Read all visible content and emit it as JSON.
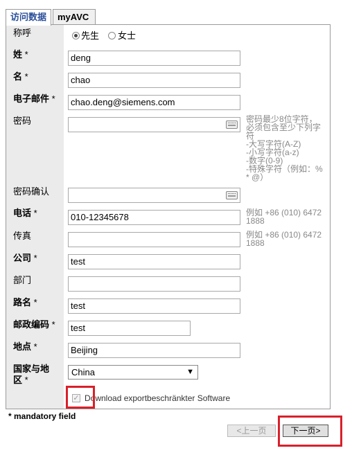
{
  "tabs": [
    {
      "label": "访问数据",
      "active": true
    },
    {
      "label": "myAVC",
      "active": false
    }
  ],
  "form": {
    "salutation": {
      "label": "称呼",
      "options": [
        {
          "label": "先生",
          "selected": true
        },
        {
          "label": "女士",
          "selected": false
        }
      ]
    },
    "last_name": {
      "label": "姓",
      "required_mark": "*",
      "value": "deng"
    },
    "first_name": {
      "label": "名",
      "required_mark": "*",
      "value": "chao"
    },
    "email": {
      "label": "电子邮件",
      "required_mark": "*",
      "value": "chao.deng@siemens.com"
    },
    "password": {
      "label": "密码",
      "value": "",
      "hint": [
        "密码最少8位字符，",
        "必须包含至少下列字",
        "符",
        "-大写字符(A-Z)",
        "-小写字符(a-z)",
        "-数字(0-9)",
        "-特殊字符（例如：%",
        "* @）"
      ]
    },
    "password_confirm": {
      "label": "密码确认",
      "value": ""
    },
    "phone": {
      "label": "电话",
      "required_mark": "*",
      "value": "010-12345678",
      "hint": [
        "例如 +86 (010) 6472",
        "1888"
      ]
    },
    "fax": {
      "label": "传真",
      "value": "",
      "hint": [
        "例如 +86 (010) 6472",
        "1888"
      ]
    },
    "company": {
      "label": "公司",
      "required_mark": "*",
      "value": "test"
    },
    "department": {
      "label": "部门",
      "value": ""
    },
    "street": {
      "label": "路名",
      "required_mark": "*",
      "value": "test"
    },
    "postal_code": {
      "label": "邮政编码",
      "required_mark": "*",
      "value": "test"
    },
    "city": {
      "label": "地点",
      "required_mark": "*",
      "value": "Beijing"
    },
    "country": {
      "label_line1": "国家与地",
      "label_line2": "区",
      "required_mark": "*",
      "value": "China"
    },
    "download_checkbox": {
      "label": "Download exportbeschränkter Software",
      "checked": true
    }
  },
  "mandatory_note": "* mandatory field",
  "buttons": {
    "prev": "<上一页",
    "next": "下一页>"
  },
  "colors": {
    "highlight": "#d9202a",
    "active_tab_text": "#2b4f9a",
    "label_column": "#ebebeb"
  }
}
